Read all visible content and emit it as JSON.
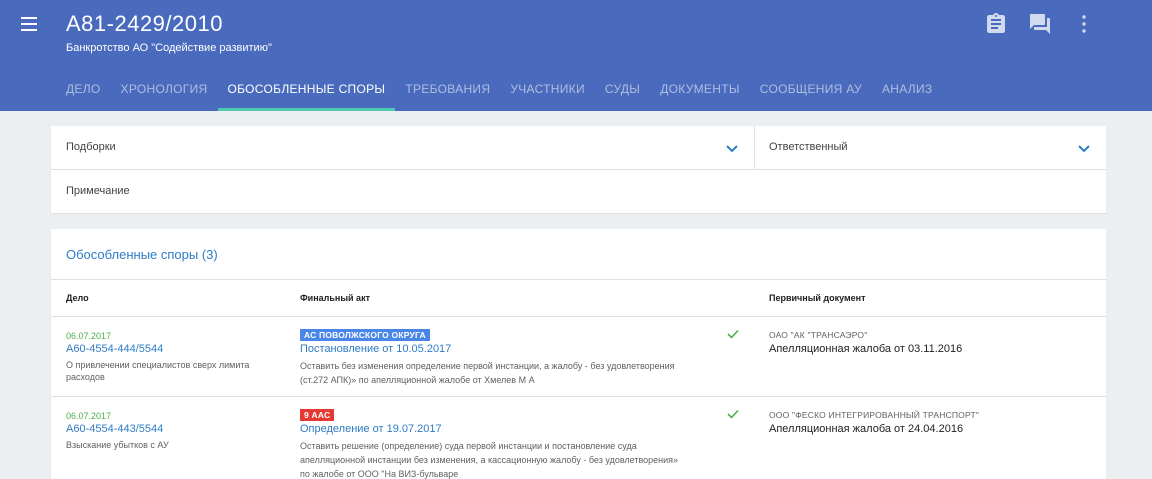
{
  "header": {
    "title": "А81-2429/2010",
    "subtitle": "Банкротство АО \"Содействие развитию\"",
    "background_color": "#4a6bbd",
    "icons": [
      "menu-icon",
      "clipboard-icon",
      "chat-icon",
      "more-vert-icon"
    ]
  },
  "tabs": [
    {
      "label": "ДЕЛО",
      "active": false
    },
    {
      "label": "ХРОНОЛОГИЯ",
      "active": false
    },
    {
      "label": "ОБОСОБЛЕННЫЕ СПОРЫ",
      "active": true
    },
    {
      "label": "ТРЕБОВАНИЯ",
      "active": false
    },
    {
      "label": "УЧАСТНИКИ",
      "active": false
    },
    {
      "label": "СУДЫ",
      "active": false
    },
    {
      "label": "ДОКУМЕНТЫ",
      "active": false
    },
    {
      "label": "СООБЩЕНИЯ АУ",
      "active": false
    },
    {
      "label": "АНАЛИЗ",
      "active": false
    }
  ],
  "filters": {
    "collections_label": "Подборки",
    "responsible_label": "Ответственный",
    "note_label": "Примечание"
  },
  "disputes": {
    "title": "Обособленные споры (3)",
    "columns": {
      "case": "Дело",
      "final_act": "Финальный акт",
      "primary_doc": "Первичный документ"
    },
    "rows": [
      {
        "date": "06.07.2017",
        "case_number": "А60-4554-444/5544",
        "case_desc": "О привлечении специалистов сверх лимита расходов",
        "court_badge": "АС ПОВОЛЖСКОГО ОКРУГА",
        "badge_color": "#4a86e8",
        "act_title": "Постановление от 10.05.2017",
        "act_desc": "Оставить без изменения определение первой инстанции, а жалобу - без удовлетворения (ст.272 АПК)» по апелляционной жалобе от Хмелев М А",
        "checked": true,
        "org": "ОАО \"АК \"ТРАНСАЭРО\"",
        "document": "Апелляционная жалоба от 03.11.2016"
      },
      {
        "date": "06.07.2017",
        "case_number": "А60-4554-443/5544",
        "case_desc": "Взыскание убытков с АУ",
        "court_badge": "9 ААС",
        "badge_color": "#e53935",
        "act_title": "Определение от 19.07.2017",
        "act_desc": "Оставить решение (определение) суда первой инстанции и постановление суда апелляционной инстанции без изменения, а кассационную жалобу - без удовлетворения» по жалобе от ООО \"На ВИЗ-бульваре",
        "checked": true,
        "org": "ООО \"ФЕСКО ИНТЕГРИРОВАННЫЙ ТРАНСПОРТ\"",
        "document": "Апелляционная жалоба от 24.04.2016"
      }
    ]
  }
}
